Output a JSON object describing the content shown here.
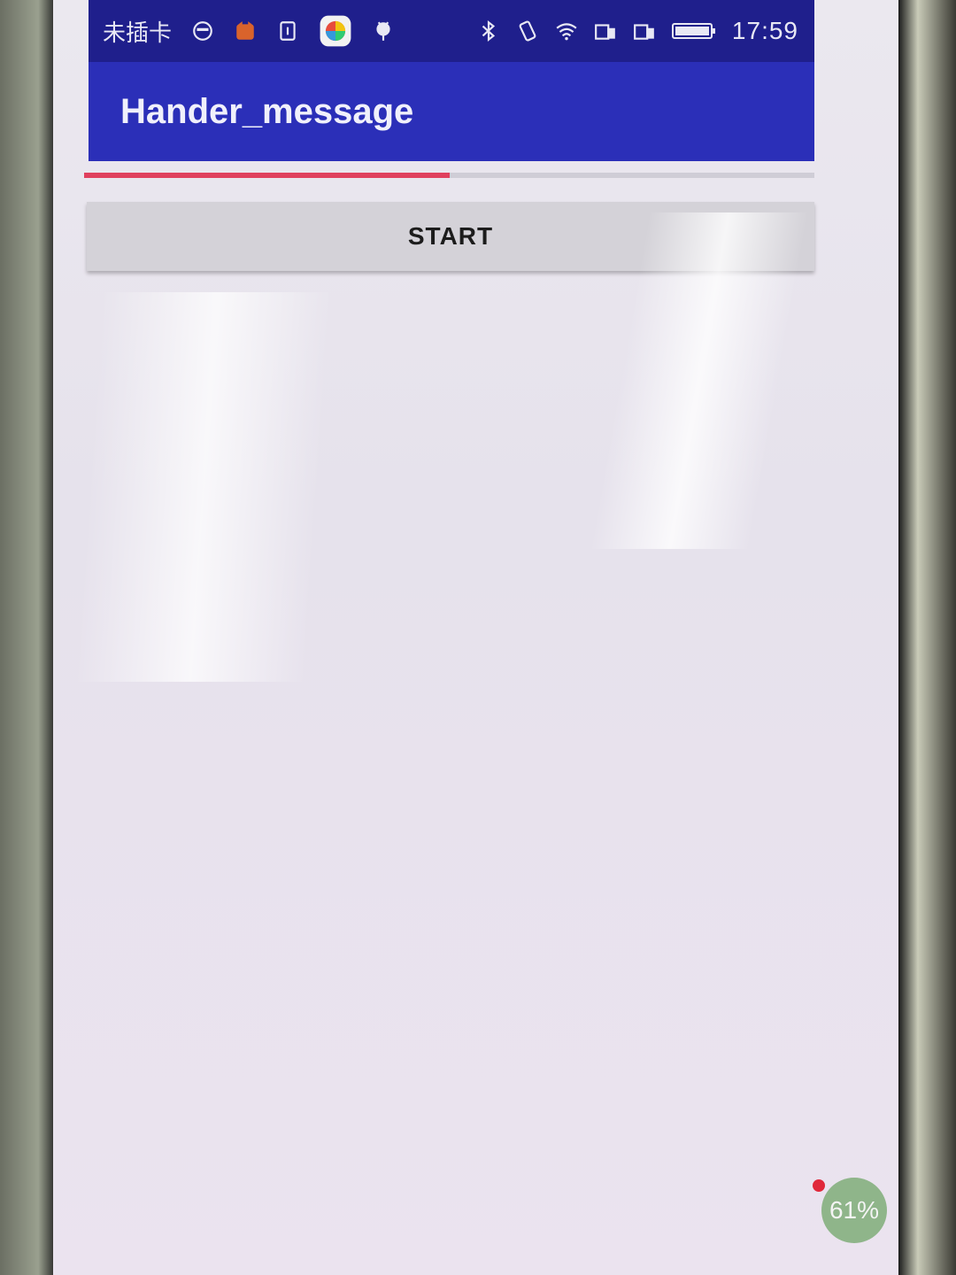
{
  "status_bar": {
    "carrier": "未插卡",
    "time": "17:59",
    "icons": [
      "face-icon",
      "cat-app-icon",
      "sim-icon",
      "game-center-icon",
      "android-icon",
      "bluetooth-icon",
      "vibrate-icon",
      "wifi-icon",
      "sim-slot-1-icon",
      "sim-slot-2-icon",
      "battery-icon"
    ]
  },
  "app_bar": {
    "title": "Hander_message",
    "color": "#2b2fb8"
  },
  "progress": {
    "value": 0.5,
    "color": "#e0405e"
  },
  "start_button": {
    "label": "START"
  },
  "floating_ball": {
    "label": "61%",
    "color": "#8fb58a"
  }
}
